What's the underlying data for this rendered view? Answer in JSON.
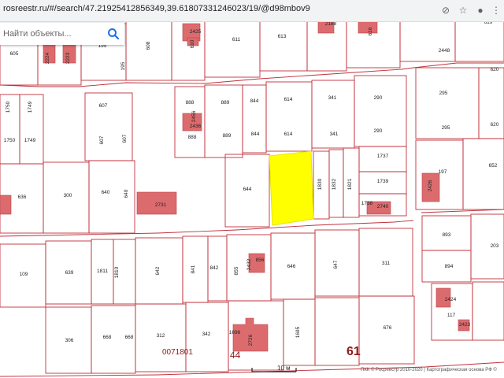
{
  "browser": {
    "url": "rosreestr.ru/#/search/47.21925412856349,39.61807331246023/19/@d98mbov9"
  },
  "search": {
    "placeholder": "Найти объекты..."
  },
  "map": {
    "colors": {
      "parcel_line": "#c0303a",
      "building_fill": "#dc6b6e",
      "highlight_fill": "#ffff00",
      "label_text": "#222222",
      "district_text": "#8b1a1a"
    },
    "district_labels": {
      "big": "61",
      "block": "44",
      "quarter": "0071801"
    },
    "scale_label": "10 м",
    "attribution": "ПКК © Росреестр 2010-2020 | Картографическая основа РФ ©",
    "parcel_labels": [
      "605",
      "2224",
      "2223",
      "195",
      "608",
      "2425",
      "610",
      "611",
      "613",
      "2188",
      "616",
      "2449",
      "619",
      "2448",
      "195",
      "620",
      "1750",
      "1749",
      "607",
      "888",
      "889",
      "844",
      "614",
      "341",
      "290",
      "295",
      "2456",
      "2436",
      "1750",
      "1749",
      "607",
      "607",
      "888",
      "889",
      "844",
      "614",
      "341",
      "290",
      "295",
      "620",
      "1737",
      "652",
      "636",
      "300",
      "640",
      "640",
      "2731",
      "644",
      "1830",
      "1832",
      "1821",
      "1739",
      "197",
      "2426",
      "1738",
      "2740",
      "893",
      "203",
      "109",
      "639",
      "1811",
      "1810",
      "642",
      "841",
      "842",
      "855",
      "2432",
      "856",
      "646",
      "647",
      "311",
      "894",
      "306",
      "668",
      "668",
      "312",
      "342",
      "1696",
      "2726",
      "1695",
      "676",
      "117",
      "2424",
      "2423"
    ]
  }
}
